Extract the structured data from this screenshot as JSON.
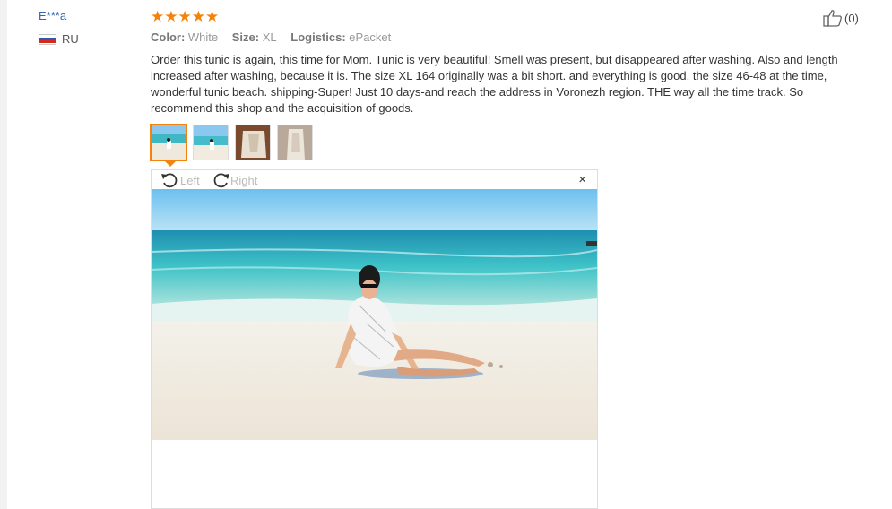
{
  "reviewer": {
    "name": "E***a",
    "country": "RU"
  },
  "rating": {
    "stars": 5,
    "max": 5
  },
  "likes": {
    "count": "(0)"
  },
  "meta": {
    "color_label": "Color:",
    "color_value": "White",
    "size_label": "Size:",
    "size_value": "XL",
    "logistics_label": "Logistics:",
    "logistics_value": "ePacket"
  },
  "review_text": "Order this tunic is again, this time for Mom. Tunic is very beautiful! Smell was present, but disappeared after washing. Also and length increased after washing, because it is. The size XL 164 originally was a bit short. and everything is good, the size 46-48 at the time, wonderful tunic beach. shipping-Super! Just 10 days-and reach the address in Voronezh region. THE way all the time track. So recommend this shop and the acquisition of goods.",
  "viewer": {
    "rotate_left": "Left",
    "rotate_right": "Right",
    "close": "×"
  },
  "colors": {
    "accent": "#f5820a",
    "link": "#3366b3"
  }
}
